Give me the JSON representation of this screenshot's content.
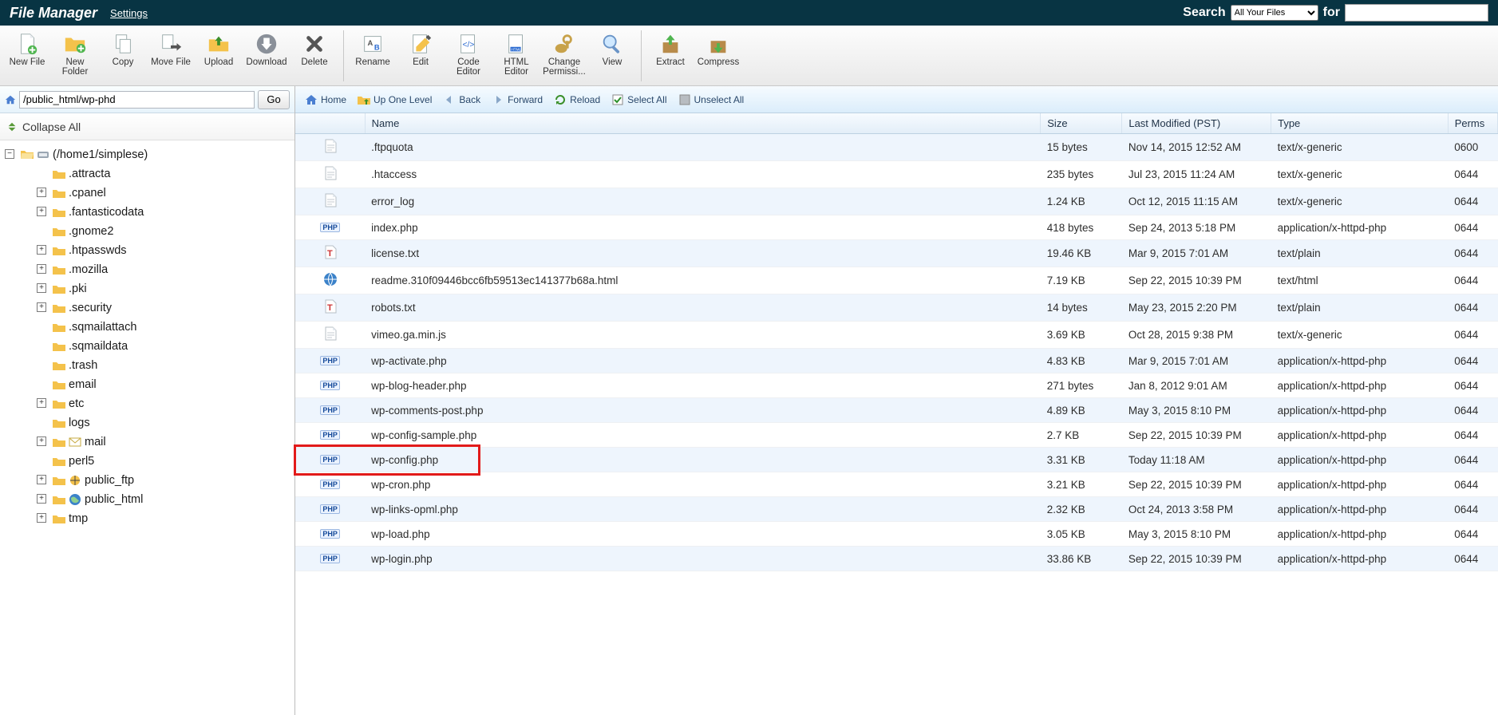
{
  "topbar": {
    "title": "File Manager",
    "settings_label": "Settings",
    "search_label": "Search",
    "search_scope_option": "All Your Files",
    "for_label": "for",
    "search_value": ""
  },
  "toolbar": [
    {
      "id": "newfile",
      "label": "New File"
    },
    {
      "id": "newfolder",
      "label": "New Folder"
    },
    {
      "id": "copy",
      "label": "Copy"
    },
    {
      "id": "movefile",
      "label": "Move File"
    },
    {
      "id": "upload",
      "label": "Upload"
    },
    {
      "id": "download",
      "label": "Download"
    },
    {
      "id": "delete",
      "label": "Delete"
    },
    {
      "divider": true
    },
    {
      "id": "rename",
      "label": "Rename"
    },
    {
      "id": "edit",
      "label": "Edit"
    },
    {
      "id": "codeeditor",
      "label": "Code Editor"
    },
    {
      "id": "htmleditor",
      "label": "HTML Editor"
    },
    {
      "id": "changeperm",
      "label": "Change Permissi..."
    },
    {
      "id": "view",
      "label": "View"
    },
    {
      "divider": true
    },
    {
      "id": "extract",
      "label": "Extract"
    },
    {
      "id": "compress",
      "label": "Compress"
    }
  ],
  "path": {
    "value": "/public_html/wp-phd",
    "go_label": "Go"
  },
  "nav": {
    "home": "Home",
    "up": "Up One Level",
    "back": "Back",
    "forward": "Forward",
    "reload": "Reload",
    "select_all": "Select All",
    "unselect_all": "Unselect All"
  },
  "sidebar": {
    "collapse_all": "Collapse All",
    "root_label": "(/home1/simplese)",
    "tree": [
      {
        "name": ".attracta",
        "expandable": false
      },
      {
        "name": ".cpanel",
        "expandable": true
      },
      {
        "name": ".fantasticodata",
        "expandable": true
      },
      {
        "name": ".gnome2",
        "expandable": false
      },
      {
        "name": ".htpasswds",
        "expandable": true
      },
      {
        "name": ".mozilla",
        "expandable": true
      },
      {
        "name": ".pki",
        "expandable": true
      },
      {
        "name": ".security",
        "expandable": true
      },
      {
        "name": ".sqmailattach",
        "expandable": false
      },
      {
        "name": ".sqmaildata",
        "expandable": false
      },
      {
        "name": ".trash",
        "expandable": false
      },
      {
        "name": "email",
        "expandable": false
      },
      {
        "name": "etc",
        "expandable": true
      },
      {
        "name": "logs",
        "expandable": false
      },
      {
        "name": "mail",
        "expandable": true,
        "extra_icon": "mail"
      },
      {
        "name": "perl5",
        "expandable": false
      },
      {
        "name": "public_ftp",
        "expandable": true,
        "extra_icon": "ftp"
      },
      {
        "name": "public_html",
        "expandable": true,
        "extra_icon": "globe"
      },
      {
        "name": "tmp",
        "expandable": true
      }
    ]
  },
  "table": {
    "columns": {
      "name": "Name",
      "size": "Size",
      "modified": "Last Modified (PST)",
      "type": "Type",
      "perms": "Perms"
    },
    "rows": [
      {
        "icon": "doc",
        "name": ".ftpquota",
        "size": "15 bytes",
        "modified": "Nov 14, 2015 12:52 AM",
        "type": "text/x-generic",
        "perms": "0600"
      },
      {
        "icon": "doc",
        "name": ".htaccess",
        "size": "235 bytes",
        "modified": "Jul 23, 2015 11:24 AM",
        "type": "text/x-generic",
        "perms": "0644"
      },
      {
        "icon": "doc",
        "name": "error_log",
        "size": "1.24 KB",
        "modified": "Oct 12, 2015 11:15 AM",
        "type": "text/x-generic",
        "perms": "0644"
      },
      {
        "icon": "php",
        "name": "index.php",
        "size": "418 bytes",
        "modified": "Sep 24, 2013 5:18 PM",
        "type": "application/x-httpd-php",
        "perms": "0644"
      },
      {
        "icon": "txt",
        "name": "license.txt",
        "size": "19.46 KB",
        "modified": "Mar 9, 2015 7:01 AM",
        "type": "text/plain",
        "perms": "0644"
      },
      {
        "icon": "html",
        "name": "readme.310f09446bcc6fb59513ec141377b68a.html",
        "size": "7.19 KB",
        "modified": "Sep 22, 2015 10:39 PM",
        "type": "text/html",
        "perms": "0644"
      },
      {
        "icon": "txt",
        "name": "robots.txt",
        "size": "14 bytes",
        "modified": "May 23, 2015 2:20 PM",
        "type": "text/plain",
        "perms": "0644"
      },
      {
        "icon": "doc",
        "name": "vimeo.ga.min.js",
        "size": "3.69 KB",
        "modified": "Oct 28, 2015 9:38 PM",
        "type": "text/x-generic",
        "perms": "0644"
      },
      {
        "icon": "php",
        "name": "wp-activate.php",
        "size": "4.83 KB",
        "modified": "Mar 9, 2015 7:01 AM",
        "type": "application/x-httpd-php",
        "perms": "0644"
      },
      {
        "icon": "php",
        "name": "wp-blog-header.php",
        "size": "271 bytes",
        "modified": "Jan 8, 2012 9:01 AM",
        "type": "application/x-httpd-php",
        "perms": "0644"
      },
      {
        "icon": "php",
        "name": "wp-comments-post.php",
        "size": "4.89 KB",
        "modified": "May 3, 2015 8:10 PM",
        "type": "application/x-httpd-php",
        "perms": "0644"
      },
      {
        "icon": "php",
        "name": "wp-config-sample.php",
        "size": "2.7 KB",
        "modified": "Sep 22, 2015 10:39 PM",
        "type": "application/x-httpd-php",
        "perms": "0644"
      },
      {
        "icon": "php",
        "name": "wp-config.php",
        "size": "3.31 KB",
        "modified": "Today 11:18 AM",
        "type": "application/x-httpd-php",
        "perms": "0644",
        "highlight": true
      },
      {
        "icon": "php",
        "name": "wp-cron.php",
        "size": "3.21 KB",
        "modified": "Sep 22, 2015 10:39 PM",
        "type": "application/x-httpd-php",
        "perms": "0644"
      },
      {
        "icon": "php",
        "name": "wp-links-opml.php",
        "size": "2.32 KB",
        "modified": "Oct 24, 2013 3:58 PM",
        "type": "application/x-httpd-php",
        "perms": "0644"
      },
      {
        "icon": "php",
        "name": "wp-load.php",
        "size": "3.05 KB",
        "modified": "May 3, 2015 8:10 PM",
        "type": "application/x-httpd-php",
        "perms": "0644"
      },
      {
        "icon": "php",
        "name": "wp-login.php",
        "size": "33.86 KB",
        "modified": "Sep 22, 2015 10:39 PM",
        "type": "application/x-httpd-php",
        "perms": "0644"
      }
    ]
  }
}
